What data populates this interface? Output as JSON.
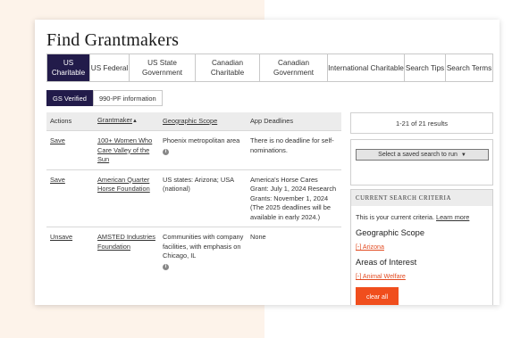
{
  "page": {
    "title": "Find Grantmakers"
  },
  "tabs": [
    {
      "label": "US Charitable",
      "active": true
    },
    {
      "label": "US Federal",
      "active": false
    },
    {
      "label": "US State Government",
      "active": false
    },
    {
      "label": "Canadian Charitable",
      "active": false
    },
    {
      "label": "Canadian Government",
      "active": false
    },
    {
      "label": "International Charitable",
      "active": false
    },
    {
      "label": "Search Tips",
      "active": false
    },
    {
      "label": "Search Terms",
      "active": false
    }
  ],
  "subtabs": [
    {
      "label": "GS Verified",
      "active": true
    },
    {
      "label": "990-PF information",
      "active": false
    }
  ],
  "table": {
    "headers": [
      "Actions",
      "Grantmaker",
      "Geographic Scope",
      "App Deadlines"
    ],
    "sort_indicator": "▲",
    "rows": [
      {
        "action": "Save",
        "grantmaker": "100+ Women Who Care Valley of the Sun",
        "scope": "Phoenix metropolitan area",
        "deadlines": "There is no deadline for self-nominations."
      },
      {
        "action": "Save",
        "grantmaker": "American Quarter Horse Foundation",
        "scope": "US states: Arizona; USA (national)",
        "deadlines": "America's Horse Cares Grant: July 1, 2024 Research Grants: November 1, 2024 (The 2025 deadlines will be available in early 2024.)"
      },
      {
        "action": "Unsave",
        "grantmaker": "AMSTED Industries Foundation",
        "scope": "Communities with company facilities, with emphasis on Chicago, IL",
        "deadlines": "None"
      }
    ]
  },
  "sidebar": {
    "results_count": "1-21 of 21 results",
    "saved_search_label": "Select a saved search to run",
    "criteria": {
      "heading": "CURRENT SEARCH CRITERIA",
      "intro": "This is your current criteria.",
      "learn_more": "Learn more",
      "groups": [
        {
          "label": "Geographic Scope",
          "value": "[-] Arizona"
        },
        {
          "label": "Areas of Interest",
          "value": "[-] Animal Welfare"
        }
      ],
      "clear_label": "clear all"
    }
  },
  "colors": {
    "active_tab": "#221b4a",
    "accent": "#f04e1d",
    "background_left": "#fdf3ea"
  },
  "icons": [
    "info-icon",
    "sort-up-icon",
    "caret-down-icon"
  ]
}
